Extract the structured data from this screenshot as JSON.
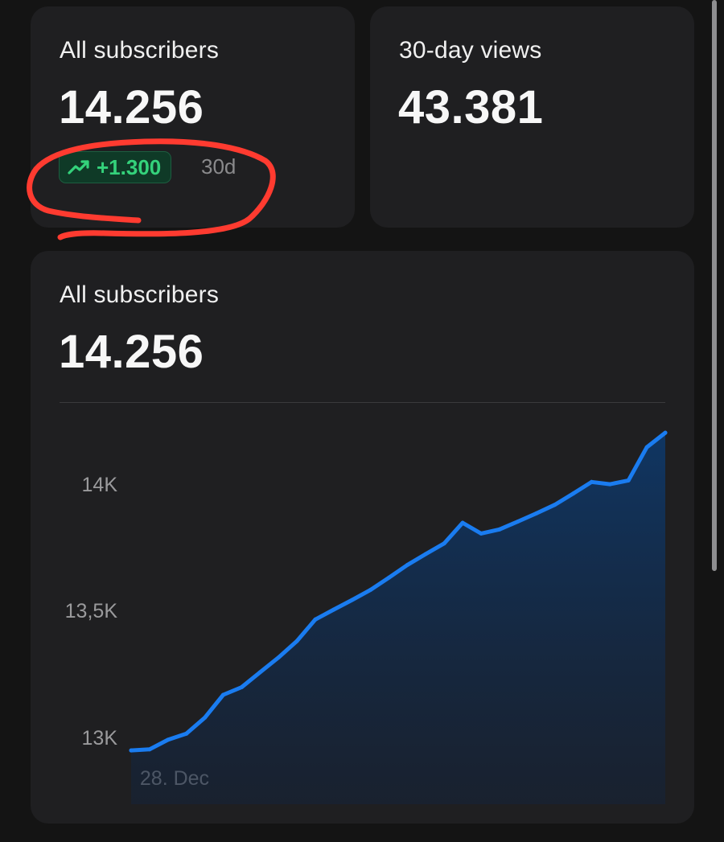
{
  "cards": {
    "subscribers": {
      "label": "All subscribers",
      "value": "14.256",
      "change": "+1.300",
      "period": "30d"
    },
    "views": {
      "label": "30-day views",
      "value": "43.381"
    }
  },
  "chart_card": {
    "label": "All subscribers",
    "value": "14.256"
  },
  "colors": {
    "line": "#1a7cf0",
    "positive": "#34d27b",
    "annotation": "#ff3b30"
  },
  "icons": {
    "trend": "trending-up-icon"
  },
  "chart_data": {
    "type": "area",
    "ylim": [
      12950,
      14240
    ],
    "y_ticks": [
      {
        "value": 14000,
        "label": "14K"
      },
      {
        "value": 13500,
        "label": "13,5K"
      },
      {
        "value": 13000,
        "label": "13K"
      }
    ],
    "x_ticks": [
      {
        "index": 1,
        "label": "28. Dec"
      }
    ],
    "series": [
      {
        "values": [
          12956,
          12960,
          12998,
          13022,
          13085,
          13175,
          13205,
          13264,
          13322,
          13387,
          13472,
          13511,
          13549,
          13589,
          13637,
          13687,
          13730,
          13772,
          13853,
          13811,
          13827,
          13858,
          13890,
          13924,
          13968,
          14014,
          14005,
          14020,
          14151,
          14208
        ]
      }
    ],
    "grid": false,
    "legend": "none"
  }
}
